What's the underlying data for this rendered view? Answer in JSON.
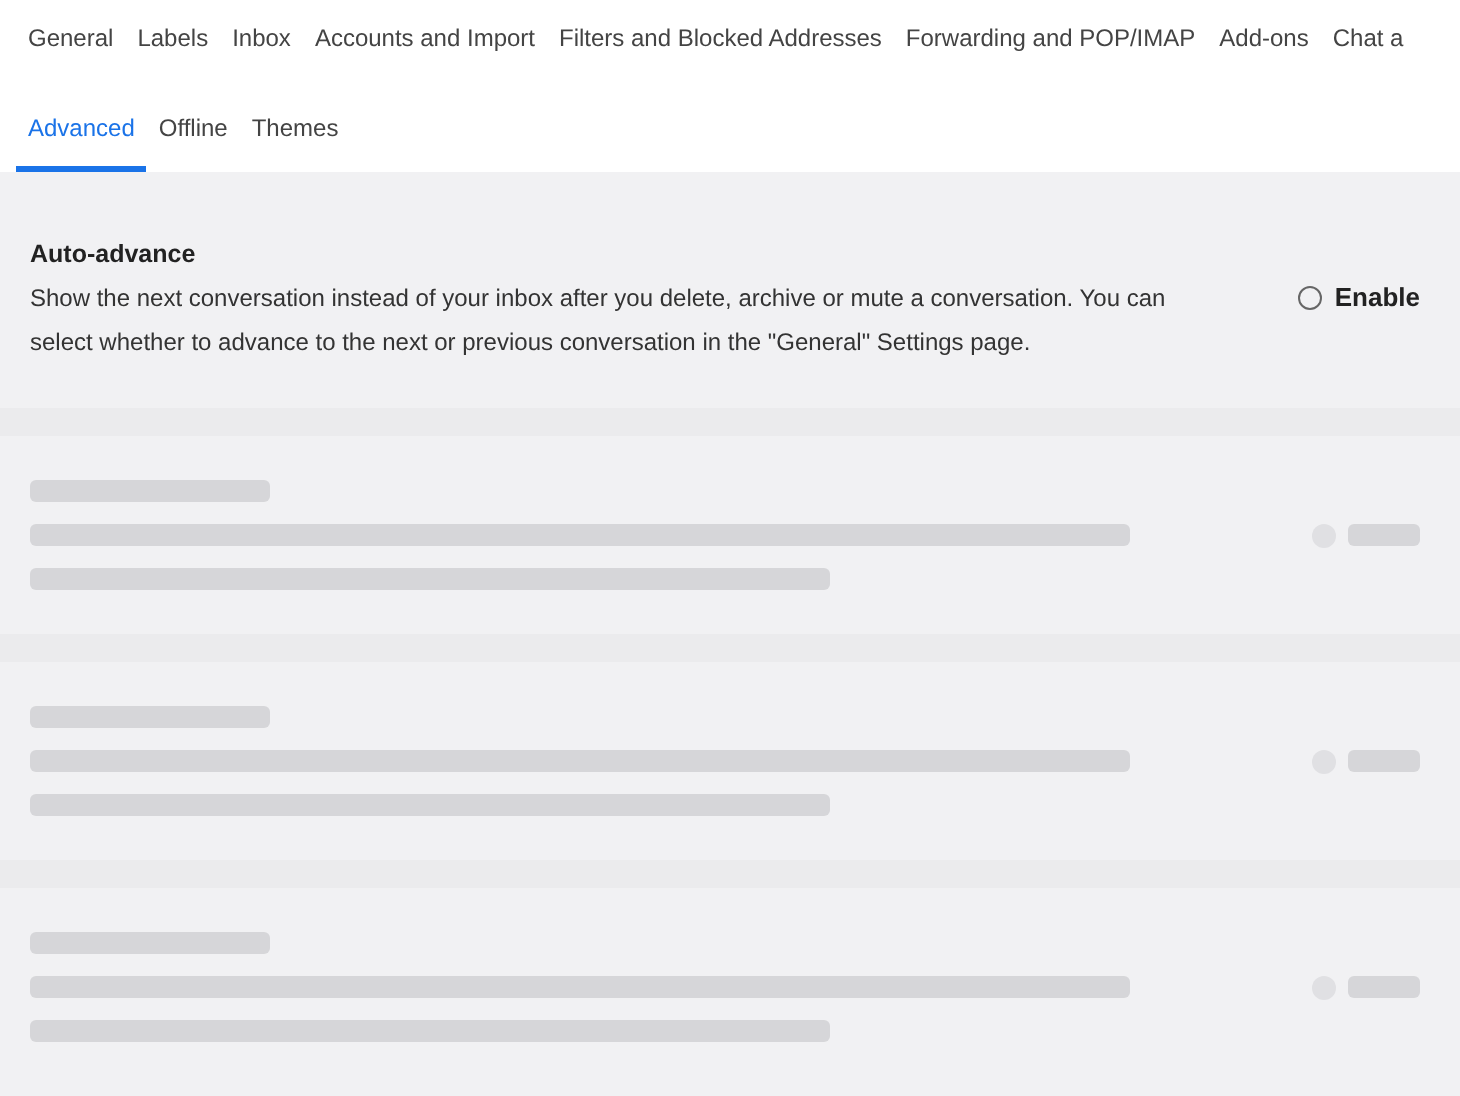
{
  "tabs_row_1": [
    {
      "label": "General",
      "selected": false
    },
    {
      "label": "Labels",
      "selected": false
    },
    {
      "label": "Inbox",
      "selected": false
    },
    {
      "label": "Accounts and Import",
      "selected": false
    },
    {
      "label": "Filters and Blocked Addresses",
      "selected": false
    },
    {
      "label": "Forwarding and POP/IMAP",
      "selected": false
    },
    {
      "label": "Add-ons",
      "selected": false
    },
    {
      "label": "Chat a",
      "selected": false
    }
  ],
  "tabs_row_2": [
    {
      "label": "Advanced",
      "selected": true
    },
    {
      "label": "Offline",
      "selected": false
    },
    {
      "label": "Themes",
      "selected": false
    }
  ],
  "settings": [
    {
      "kind": "setting",
      "title": "Auto-advance",
      "description": "Show the next conversation instead of your inbox after you delete, archive or mute a conversation. You can select whether to advance to the next or previous conversation in the \"General\" Settings page.",
      "option": {
        "label": "Enable",
        "selected": false
      }
    },
    {
      "kind": "blurred"
    },
    {
      "kind": "blurred"
    },
    {
      "kind": "blurred"
    }
  ]
}
